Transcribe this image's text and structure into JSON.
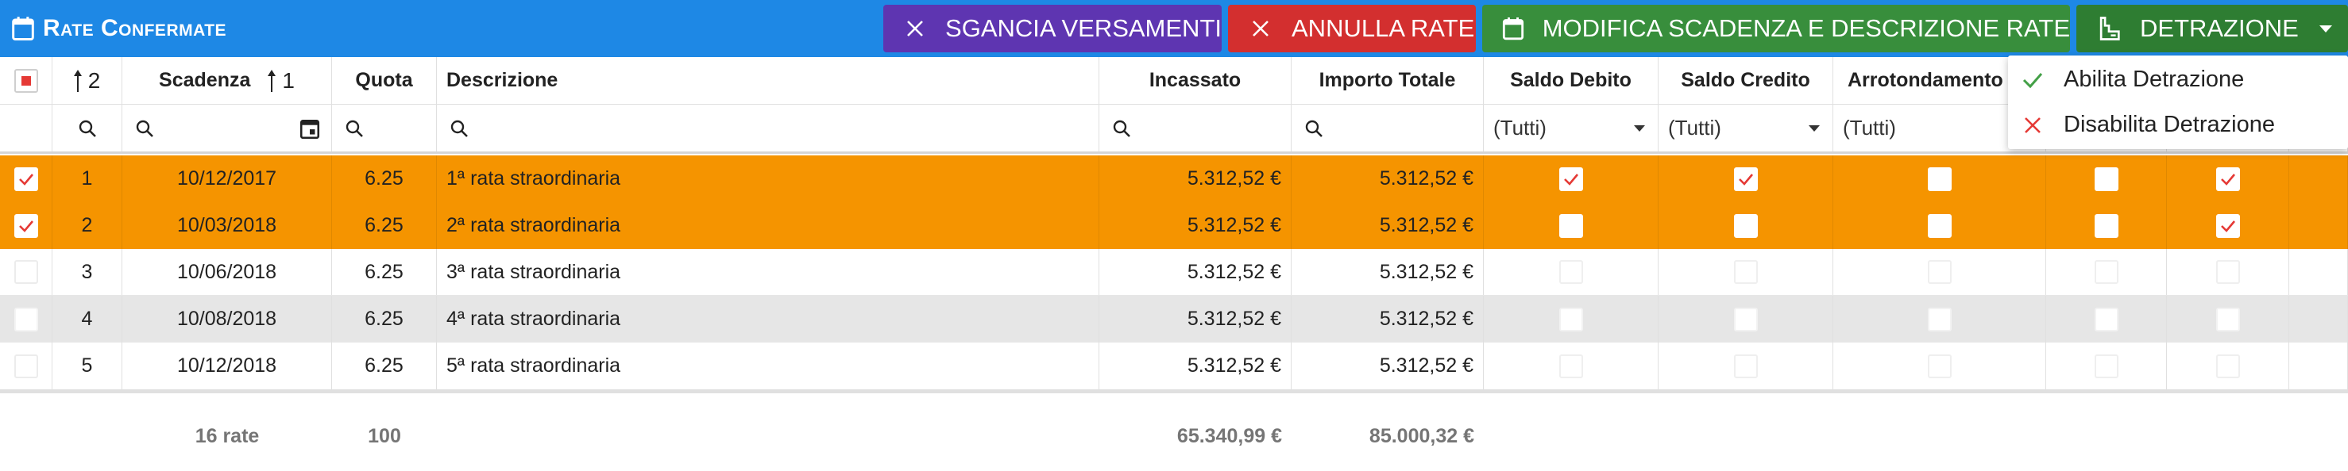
{
  "toolbar": {
    "title": "Rate Confermate",
    "buttons": {
      "sgancia": "SGANCIA VERSAMENTI",
      "annulla": "ANNULLA RATE",
      "modifica": "MODIFICA SCADENZA E DESCRIZIONE RATE",
      "detrazione": "DETRAZIONE"
    },
    "colors": {
      "bar": "#1e88e5",
      "sgancia": "#5e35b1",
      "annulla": "#d32f2f",
      "modifica": "#388e3c",
      "detrazione": "#2e7d32"
    }
  },
  "dropdown_menu": {
    "items": [
      {
        "label": "Abilita Detrazione",
        "icon": "check-icon"
      },
      {
        "label": "Disabilita Detrazione",
        "icon": "close-icon"
      }
    ]
  },
  "table": {
    "headers": {
      "num_sort": "2",
      "scadenza": "Scadenza",
      "scadenza_sort": "1",
      "quota": "Quota",
      "descrizione": "Descrizione",
      "incassato": "Incassato",
      "importo_totale": "Importo Totale",
      "saldo_debito": "Saldo Debito",
      "saldo_credito": "Saldo Credito",
      "arrotondamento": "Arrotondamento"
    },
    "filters": {
      "saldo_debito": "(Tutti)",
      "saldo_credito": "(Tutti)",
      "arrotondamento": "(Tutti)"
    },
    "rows": [
      {
        "num": "1",
        "scadenza": "10/12/2017",
        "quota": "6.25",
        "descrizione": "1ª rata straordinaria",
        "incassato": "5.312,52 €",
        "importo_totale": "5.312,52 €",
        "selected": true,
        "saldo_debito": true,
        "saldo_credito": true,
        "arrotondamento": false,
        "col10": false,
        "col11": true
      },
      {
        "num": "2",
        "scadenza": "10/03/2018",
        "quota": "6.25",
        "descrizione": "2ª rata straordinaria",
        "incassato": "5.312,52 €",
        "importo_totale": "5.312,52 €",
        "selected": true,
        "saldo_debito": false,
        "saldo_credito": false,
        "arrotondamento": false,
        "col10": false,
        "col11": true
      },
      {
        "num": "3",
        "scadenza": "10/06/2018",
        "quota": "6.25",
        "descrizione": "3ª rata straordinaria",
        "incassato": "5.312,52 €",
        "importo_totale": "5.312,52 €",
        "selected": false,
        "saldo_debito": false,
        "saldo_credito": false,
        "arrotondamento": false,
        "col10": false,
        "col11": false
      },
      {
        "num": "4",
        "scadenza": "10/08/2018",
        "quota": "6.25",
        "descrizione": "4ª rata straordinaria",
        "incassato": "5.312,52 €",
        "importo_totale": "5.312,52 €",
        "selected": false,
        "saldo_debito": false,
        "saldo_credito": false,
        "arrotondamento": false,
        "col10": false,
        "col11": false
      },
      {
        "num": "5",
        "scadenza": "10/12/2018",
        "quota": "6.25",
        "descrizione": "5ª rata straordinaria",
        "incassato": "5.312,52 €",
        "importo_totale": "5.312,52 €",
        "selected": false,
        "saldo_debito": false,
        "saldo_credito": false,
        "arrotondamento": false,
        "col10": false,
        "col11": false
      }
    ],
    "footer": {
      "count": "16 rate",
      "quota_total": "100",
      "incassato_total": "65.340,99 €",
      "importo_total": "85.000,32 €"
    },
    "colors": {
      "selected_row": "#f59400",
      "alt_row": "#e6e6e6",
      "check": "#e53935"
    }
  }
}
